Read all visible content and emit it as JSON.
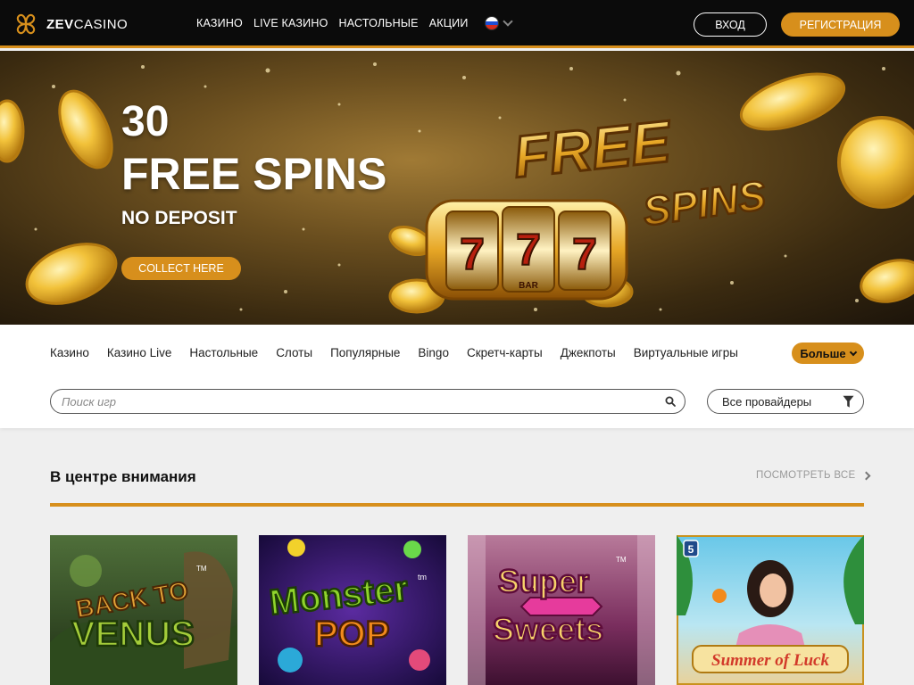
{
  "header": {
    "logo_bold": "ZEV",
    "logo_light": "CASINO",
    "nav": [
      "КАЗИНО",
      "LIVE КАЗИНО",
      "НАСТОЛЬНЫЕ",
      "АКЦИИ"
    ],
    "login_label": "ВХОД",
    "register_label": "РЕГИСТРАЦИЯ",
    "accent": "#d78f1c"
  },
  "banner": {
    "count": "30",
    "title": "FREE SPINS",
    "subtitle": "NO DEPOSIT",
    "cta_label": "COLLECT HERE",
    "art_word1": "FREE",
    "art_word2": "SPINS",
    "reel_symbol": "7",
    "reel_bar": "BAR"
  },
  "categories": {
    "items": [
      "Казино",
      "Казино Live",
      "Настольные",
      "Слоты",
      "Популярные",
      "Bingo",
      "Скретч-карты",
      "Джекпоты",
      "Виртуальные игры"
    ],
    "more_label": "Больше"
  },
  "search": {
    "placeholder": "Поиск игр",
    "providers_label": "Все провайдеры"
  },
  "featured": {
    "title": "В центре внимания",
    "view_all": "ПОСМОТРЕТЬ ВСЕ",
    "games": [
      {
        "line1": "BACK TO",
        "line2": "VENUS",
        "tm": "TM"
      },
      {
        "line1": "Monster",
        "line2": "POP",
        "tm": "tm"
      },
      {
        "line1": "Super",
        "line2": "Sweets",
        "tm": "TM"
      },
      {
        "line1": "Summer of Luck",
        "badge": "5"
      }
    ]
  }
}
